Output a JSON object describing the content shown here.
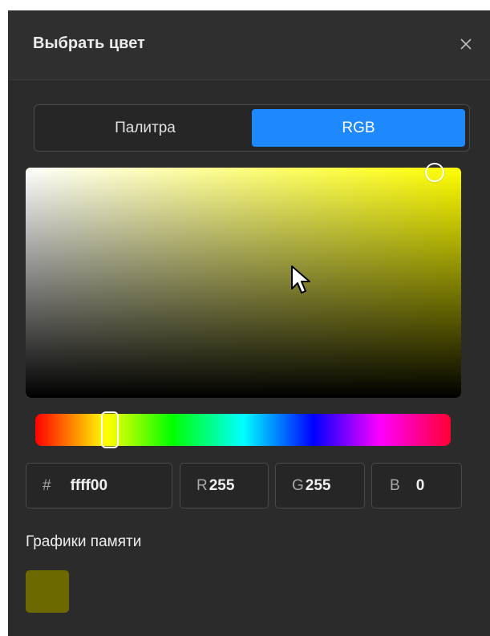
{
  "dialog": {
    "title": "Выбрать цвет"
  },
  "tabs": [
    {
      "label": "Палитра",
      "active": false
    },
    {
      "label": "RGB",
      "active": true
    }
  ],
  "color": {
    "current_hex_color": "#ffff00",
    "hue_degrees": 60,
    "saturation": 1.0,
    "value": 1.0
  },
  "fields": {
    "hex": {
      "label": "#",
      "value": "ffff00"
    },
    "r": {
      "label": "R",
      "value": "255"
    },
    "g": {
      "label": "G",
      "value": "255"
    },
    "b": {
      "label": "B",
      "value": "0"
    }
  },
  "memory": {
    "title": "Графики памяти",
    "swatches": [
      "#6b6900"
    ]
  },
  "colors": {
    "accent": "#1e88ff",
    "panel_bg": "#2b2b2b"
  }
}
